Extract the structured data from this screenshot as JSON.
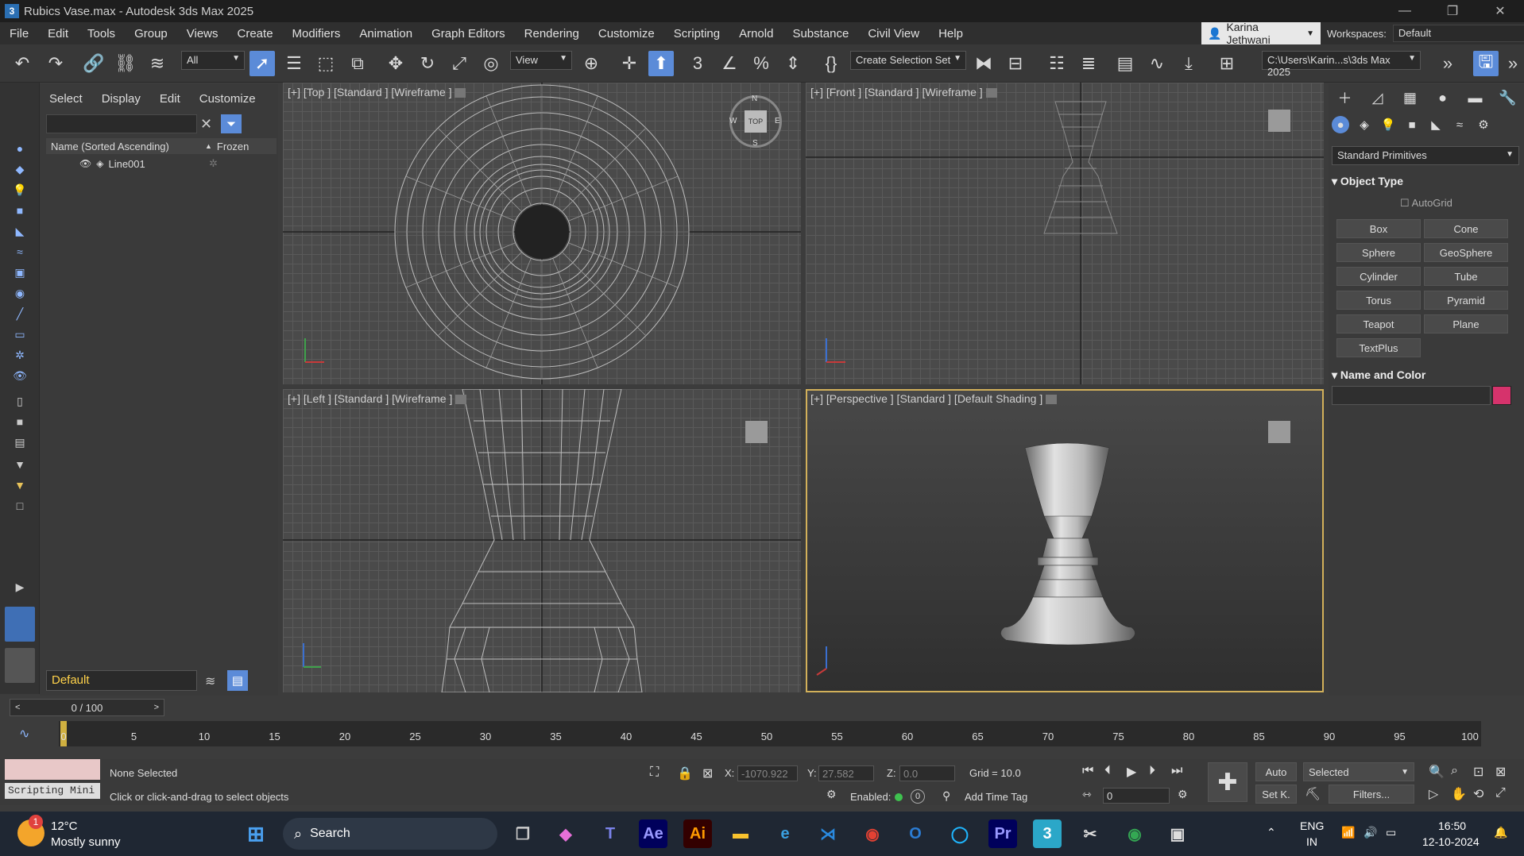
{
  "titlebar": {
    "app_icon": "3",
    "title": "Rubics Vase.max - Autodesk 3ds Max 2025"
  },
  "menu": {
    "items": [
      "File",
      "Edit",
      "Tools",
      "Group",
      "Views",
      "Create",
      "Modifiers",
      "Animation",
      "Graph Editors",
      "Rendering",
      "Customize",
      "Scripting",
      "Arnold",
      "Substance",
      "Civil View",
      "Help"
    ],
    "user": "Karina Jethwani",
    "workspaces_label": "Workspaces:",
    "workspace_value": "Default"
  },
  "toolbar": {
    "filter": "All",
    "ref_coord": "View",
    "selection_set": "Create Selection Set",
    "project_path": "C:\\Users\\Karin...s\\3ds Max 2025"
  },
  "scene_explorer": {
    "tabs": [
      "Select",
      "Display",
      "Edit",
      "Customize"
    ],
    "col_name": "Name (Sorted Ascending)",
    "col_frozen": "Frozen",
    "row_name": "Line001",
    "layer": "Default"
  },
  "viewports": {
    "top": "[+] [Top ] [Standard ] [Wireframe ]",
    "front": "[+] [Front ] [Standard ] [Wireframe ]",
    "left": "[+] [Left ] [Standard ] [Wireframe ]",
    "persp": "[+] [Perspective ] [Standard ] [Default Shading ]",
    "compass": {
      "n": "N",
      "s": "S",
      "e": "E",
      "w": "W",
      "cube": "TOP"
    }
  },
  "command_panel": {
    "dropdown": "Standard Primitives",
    "object_type": "Object Type",
    "autogrid": "AutoGrid",
    "buttons": [
      "Box",
      "Cone",
      "Sphere",
      "GeoSphere",
      "Cylinder",
      "Tube",
      "Torus",
      "Pyramid",
      "Teapot",
      "Plane",
      "TextPlus"
    ],
    "name_color": "Name and Color",
    "object_color": "#d6336c"
  },
  "timeline": {
    "frame": "0 / 100",
    "ticks": [
      "0",
      "5",
      "10",
      "15",
      "20",
      "25",
      "30",
      "35",
      "40",
      "45",
      "50",
      "55",
      "60",
      "65",
      "70",
      "75",
      "80",
      "85",
      "90",
      "95",
      "100"
    ]
  },
  "status": {
    "script_label": "Scripting Mini",
    "selection": "None Selected",
    "prompt": "Click or click-and-drag to select objects",
    "x_label": "X:",
    "x": "-1070.922",
    "y_label": "Y:",
    "y": "27.582",
    "z_label": "Z:",
    "z": "0.0",
    "grid": "Grid = 10.0",
    "enabled": "Enabled:",
    "time_tag": "Add Time Tag",
    "auto": "Auto",
    "selected": "Selected",
    "setk": "Set K.",
    "filters": "Filters...",
    "frame_field": "0",
    "enabled_count": "0"
  },
  "taskbar": {
    "weather_temp": "12°C",
    "weather_desc": "Mostly sunny",
    "weather_badge": "1",
    "search": "Search",
    "lang1": "ENG",
    "lang2": "IN",
    "time": "16:50",
    "date": "12-10-2024",
    "apps": {
      "ae": "Ae",
      "ai": "Ai",
      "pr": "Pr",
      "max": "3"
    }
  }
}
